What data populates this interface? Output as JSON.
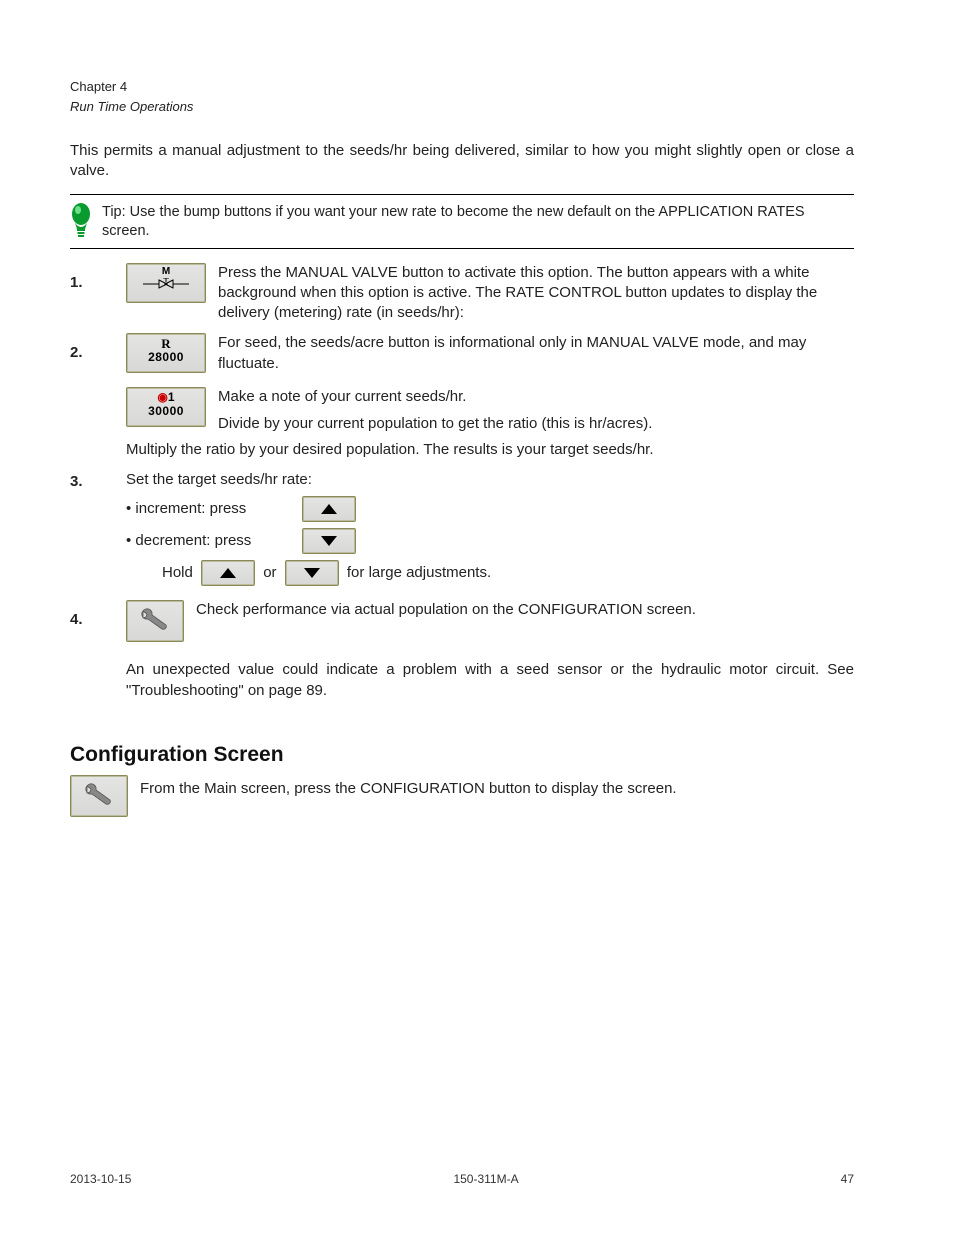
{
  "header": {
    "chapter_label": "Chapter 4",
    "chapter_title": "Run Time Operations"
  },
  "intro_para": "This permits a manual adjustment to the seeds/hr being delivered, similar to how you might slightly open or close a valve.",
  "tip": {
    "text": "Tip: Use the bump buttons if you want your new rate to become the new default on the APPLICATION RATES screen."
  },
  "steps": {
    "s1": {
      "num": "1.",
      "btn_label_top": "M",
      "text": "Press the MANUAL VALVE button to activate this option. The button appears with a white background when this option is active. The RATE CONTROL button updates to display the delivery (metering) rate (in seeds/hr):"
    },
    "s2": {
      "num": "2.",
      "btn_r_top": "R",
      "btn_r_val": "28000",
      "btn_o_top": "◎1",
      "btn_o_val": "30000",
      "text_r": "For seed, the seeds/acre button is informational only in MANUAL VALVE mode, and may fluctuate.",
      "text_o_1": "Make a note of your current seeds/hr.",
      "text_o_2": "Divide by your current population to get the ratio (this is hr/acres).",
      "text_o_3": "Multiply the ratio by your desired population. The results is your target seeds/hr."
    },
    "s3": {
      "num": "3.",
      "intro": "Set the target seeds/hr rate:",
      "inc_label": "• increment: press",
      "dec_label": "• decrement: press",
      "hold_prefix": "Hold",
      "hold_mid": "or",
      "hold_suffix": "for large adjustments."
    },
    "s4": {
      "num": "4.",
      "text_after_btn": "Check performance via actual population on the CONFIGURATION screen.",
      "text_below": "An unexpected value could indicate a problem with a seed sensor or the hydraulic motor circuit. See \"Troubleshooting\" on page 89."
    }
  },
  "config_section": {
    "title": "Configuration Screen",
    "para": "From the Main screen, press the CONFIGURATION button to display the screen."
  },
  "footer": {
    "date": "2013-10-15",
    "doc_id": "150-311M-A",
    "page_num": "47"
  }
}
